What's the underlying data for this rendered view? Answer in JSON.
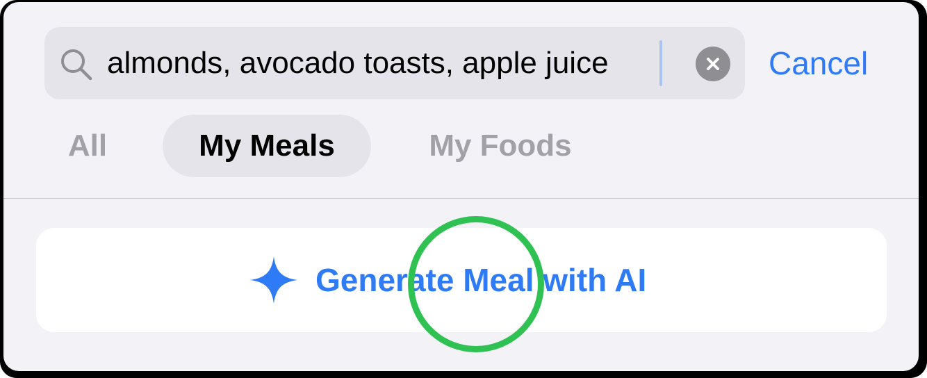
{
  "search": {
    "query": "almonds, avocado toasts, apple juice",
    "search_icon": "search-icon",
    "clear_icon": "clear-circle-icon",
    "cancel_label": "Cancel"
  },
  "tabs": [
    {
      "label": "All",
      "selected": false
    },
    {
      "label": "My Meals",
      "selected": true
    },
    {
      "label": "My Foods",
      "selected": false
    }
  ],
  "ai_action": {
    "label": "Generate Meal with AI",
    "icon": "sparkle-icon"
  },
  "colors": {
    "accent": "#2f7bf5",
    "tap_marker": "#2fc252",
    "background": "#f2f2f7"
  }
}
